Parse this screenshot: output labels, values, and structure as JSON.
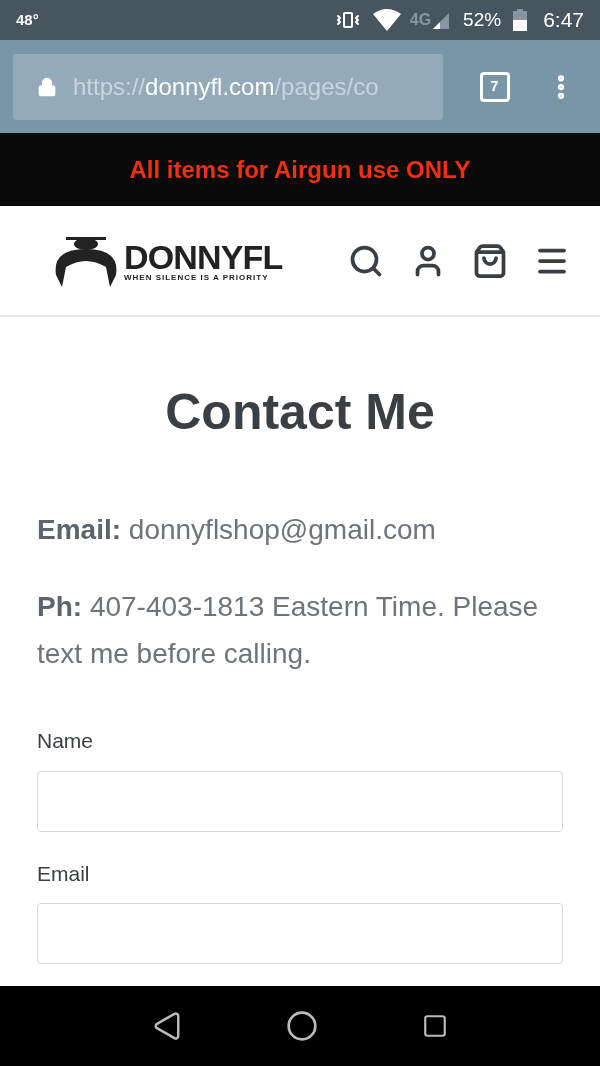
{
  "status_bar": {
    "temperature": "48°",
    "network": "4G",
    "battery": "52%",
    "time": "6:47"
  },
  "browser": {
    "url_scheme": "https://",
    "url_host": "donnyfl.com",
    "url_path": "/pages/co",
    "tab_count": "7"
  },
  "announcement": "All items for Airgun use ONLY",
  "header": {
    "brand": "DONNYFL",
    "tagline": "WHEN SILENCE IS A PRIORITY"
  },
  "page": {
    "title": "Contact Me",
    "paragraphs": [
      "**Email:** donnyflshop@gmail.com",
      "**Ph:** 407-403-1813 Eastern Time. Please text me before calling."
    ]
  },
  "form": {
    "fields": [
      {
        "label": "Name"
      },
      {
        "label": "Email"
      }
    ]
  }
}
